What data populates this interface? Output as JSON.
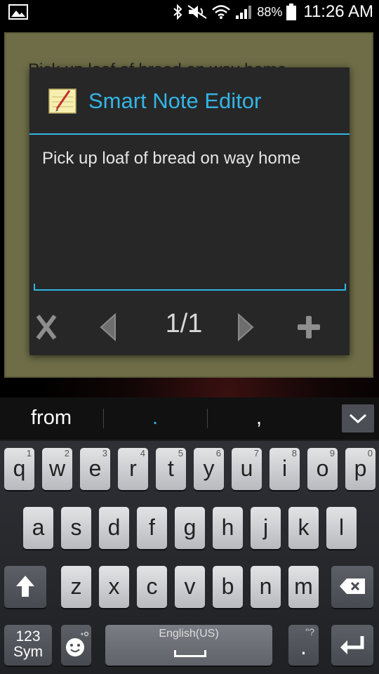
{
  "status_bar": {
    "battery_percent": "88%",
    "time": "11:26 AM",
    "icons": [
      "gallery-icon",
      "bluetooth-icon",
      "mute-icon",
      "wifi-icon",
      "signal-icon",
      "battery-icon"
    ]
  },
  "background": {
    "widget_note_text": "Pick up loaf of bread on way home"
  },
  "dialog": {
    "title": "Smart Note Editor",
    "app_icon": "note-pencil-icon",
    "note_text": "Pick up loaf of bread on way home",
    "page_indicator": "1/1",
    "actions": [
      "close-icon",
      "previous-arrow-icon",
      "next-arrow-icon",
      "add-icon"
    ]
  },
  "suggestions": {
    "items": [
      "from",
      ".",
      ","
    ],
    "collapse_icon": "chevron-down-icon"
  },
  "keyboard": {
    "row1": [
      {
        "k": "q",
        "n": "1"
      },
      {
        "k": "w",
        "n": "2"
      },
      {
        "k": "e",
        "n": "3"
      },
      {
        "k": "r",
        "n": "4"
      },
      {
        "k": "t",
        "n": "5"
      },
      {
        "k": "y",
        "n": "6"
      },
      {
        "k": "u",
        "n": "7"
      },
      {
        "k": "i",
        "n": "8"
      },
      {
        "k": "o",
        "n": "9"
      },
      {
        "k": "p",
        "n": "0"
      }
    ],
    "row2": [
      "a",
      "s",
      "d",
      "f",
      "g",
      "h",
      "j",
      "k",
      "l"
    ],
    "row3": [
      "z",
      "x",
      "c",
      "v",
      "b",
      "n",
      "m"
    ],
    "sym_label_top": "123",
    "sym_label_bottom": "Sym",
    "space_label": "English(US)",
    "period_key": ".",
    "period_hint": "\"?",
    "accent_color": "#33b5e5"
  }
}
